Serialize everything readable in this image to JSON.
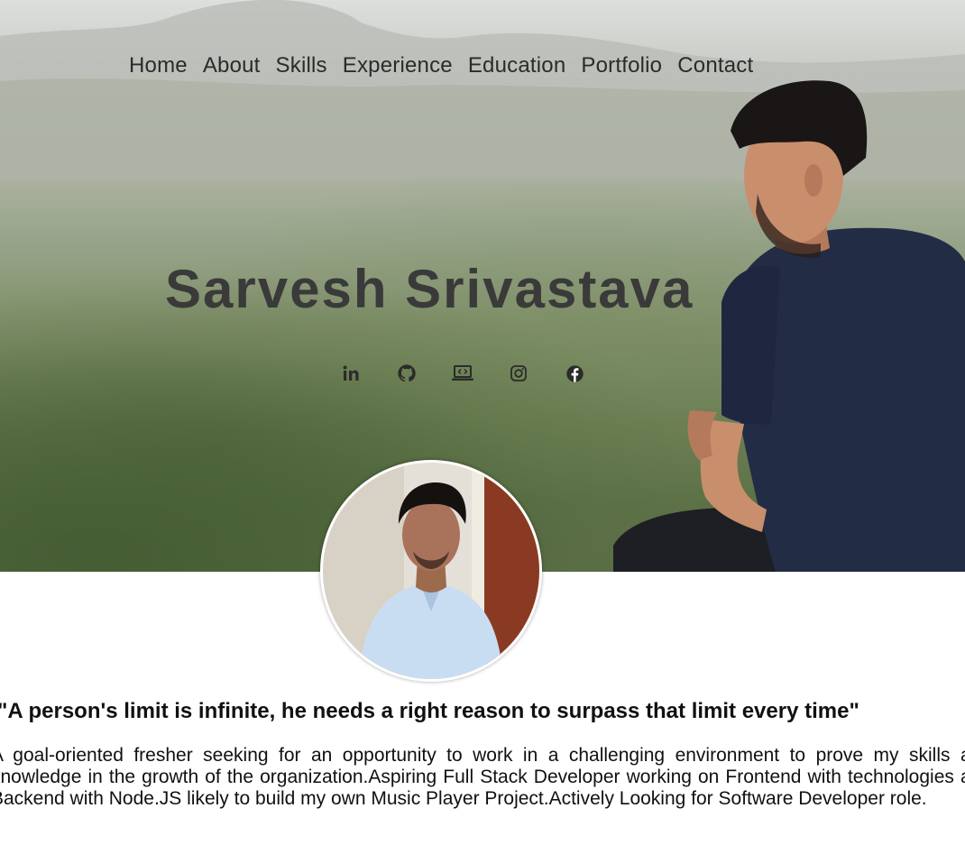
{
  "nav": {
    "items": [
      "Home",
      "About",
      "Skills",
      "Experience",
      "Education",
      "Portfolio",
      "Contact"
    ]
  },
  "hero": {
    "name": "Sarvesh Srivastava"
  },
  "social": [
    {
      "icon": "linkedin-icon"
    },
    {
      "icon": "github-icon"
    },
    {
      "icon": "laptop-code-icon"
    },
    {
      "icon": "instagram-icon"
    },
    {
      "icon": "facebook-icon"
    }
  ],
  "about": {
    "quote": "\"A person's limit is infinite, he needs a right reason to surpass that limit every time\"",
    "bio": "A goal-oriented fresher seeking for an opportunity to work in a challenging environment to prove my skills and knowledge in the growth of the organization.Aspiring Full Stack Developer working on Frontend with technologies and Backend with Node.JS likely to build my own Music Player Project.Actively Looking for Software Developer role."
  },
  "colors": {
    "nav_text": "#2b2b2b",
    "name_text": "#3a3a3a",
    "shirt": "#232c45"
  }
}
